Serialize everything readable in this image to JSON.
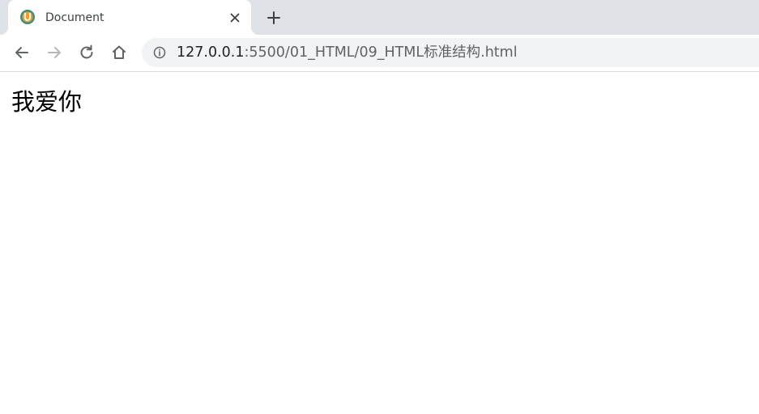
{
  "tab": {
    "title": "Document",
    "favicon": "live-server-icon"
  },
  "toolbar": {
    "back": "arrow-left-icon",
    "forward": "arrow-right-icon",
    "reload": "reload-icon",
    "home": "home-icon"
  },
  "address_bar": {
    "host": "127.0.0.1",
    "path": ":5500/01_HTML/09_HTML标准结构.html",
    "info_icon": "info-icon"
  },
  "page": {
    "text": "我爱你"
  },
  "colors": {
    "tabstrip": "#dee1e6",
    "omnibox": "#f1f3f4",
    "favicon_orange": "#f0a02a",
    "favicon_teal": "#3c8f7c"
  }
}
